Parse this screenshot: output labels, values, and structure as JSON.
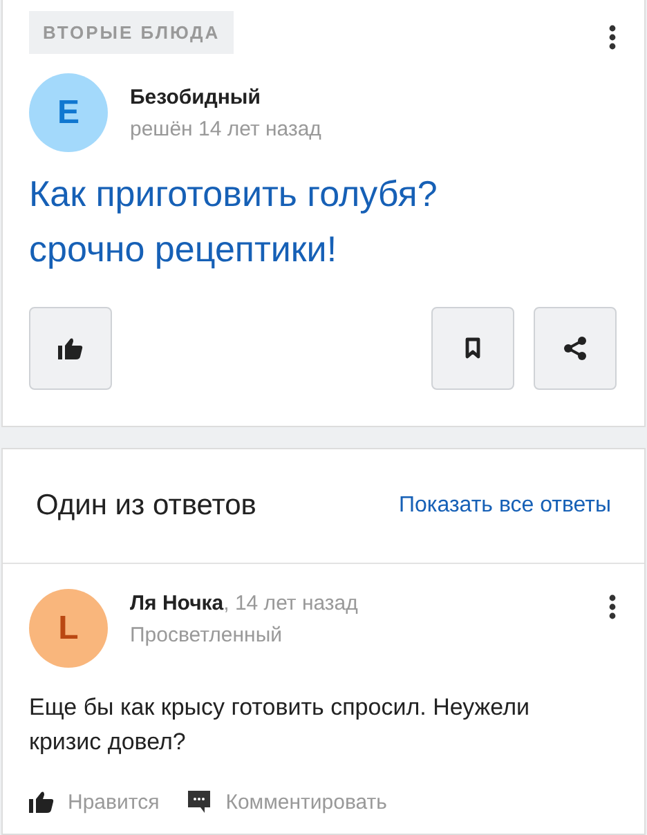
{
  "question": {
    "category": "ВТОРЫЕ БЛЮДА",
    "author": {
      "initial": "Е",
      "name": "Безобидный",
      "color": "#a3d9fb"
    },
    "status": "решён 14 лет назад",
    "title": "Как приготовить голубя? срочно рецептики!"
  },
  "answers_header": {
    "title": "Один из ответов",
    "link": "Показать все ответы"
  },
  "answer": {
    "author": {
      "initial": "L",
      "name": "Ля Ночка",
      "color": "#f9b67c"
    },
    "time": ", 14 лет назад",
    "rank": "Просветленный",
    "text": "Еще бы как крысу готовить спросил. Неужели кризис довел?",
    "actions": [
      {
        "kind": "like",
        "label": "Нравится"
      },
      {
        "kind": "comment",
        "label": "Комментировать"
      }
    ]
  }
}
